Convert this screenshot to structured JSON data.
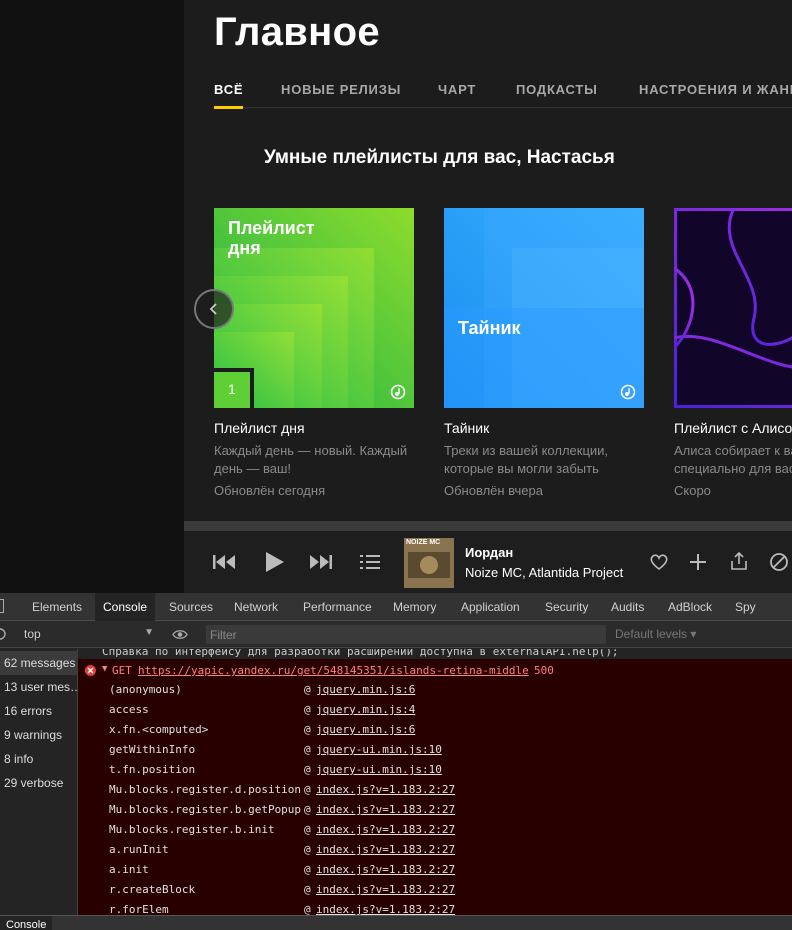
{
  "app": {
    "title": "Главное",
    "tabs": [
      "ВСЁ",
      "НОВЫЕ РЕЛИЗЫ",
      "ЧАРТ",
      "ПОДКАСТЫ",
      "НАСТРОЕНИЯ И ЖАНРЫ"
    ],
    "active_tab": "ВСЁ",
    "section_title": "Умные плейлисты для вас, Настасья",
    "cards": [
      {
        "cover_text": "Плейлист дня",
        "badge": "1",
        "name": "Плейлист дня",
        "desc": "Каждый день — новый. Каждый день — ваш!",
        "updated": "Обновлён сегодня"
      },
      {
        "cover_text": "Тайник",
        "name": "Тайник",
        "desc": "Треки из вашей коллекции, которые вы могли забыть",
        "updated": "Обновлён вчера"
      },
      {
        "cover_text": "",
        "name": "Плейлист с Алисой",
        "desc": "Алиса собирает к вам треки специально для вас",
        "updated": "Скоро"
      }
    ]
  },
  "player": {
    "track_title": "Иордан",
    "track_artist": "Noize MC, Atlantida Project",
    "cover_caption": "NOIZE MC"
  },
  "devtools": {
    "tabs": [
      "Elements",
      "Console",
      "Sources",
      "Network",
      "Performance",
      "Memory",
      "Application",
      "Security",
      "Audits",
      "AdBlock",
      "Spy"
    ],
    "active_tab": "Console",
    "context": "top",
    "filter_placeholder": "Filter",
    "levels": "Default levels ▾",
    "sidebar": [
      "62 messages",
      "13 user mes…",
      "16 errors",
      "9 warnings",
      "8 info",
      "29 verbose"
    ],
    "info_line": "Справка по интерфейсу для разработки расширений доступна в externalAPI.help();",
    "error": {
      "method": "GET",
      "url": "https://yapic.yandex.ru/get/548145351/islands-retina-middle",
      "status": "500"
    },
    "stack": [
      {
        "fn": "(anonymous)",
        "src": "jquery.min.js:6"
      },
      {
        "fn": "access",
        "src": "jquery.min.js:4"
      },
      {
        "fn": "x.fn.<computed>",
        "src": "jquery.min.js:6"
      },
      {
        "fn": "getWithinInfo",
        "src": "jquery-ui.min.js:10"
      },
      {
        "fn": "t.fn.position",
        "src": "jquery-ui.min.js:10"
      },
      {
        "fn": "Mu.blocks.register.d.position",
        "src": "index.js?v=1.183.2:27"
      },
      {
        "fn": "Mu.blocks.register.b.getPopup",
        "src": "index.js?v=1.183.2:27"
      },
      {
        "fn": "Mu.blocks.register.b.init",
        "src": "index.js?v=1.183.2:27"
      },
      {
        "fn": "a.runInit",
        "src": "index.js?v=1.183.2:27"
      },
      {
        "fn": "a.init",
        "src": "index.js?v=1.183.2:27"
      },
      {
        "fn": "r.createBlock",
        "src": "index.js?v=1.183.2:27"
      },
      {
        "fn": "r.forElem",
        "src": "index.js?v=1.183.2:27"
      }
    ],
    "bottom_tab": "Console"
  }
}
